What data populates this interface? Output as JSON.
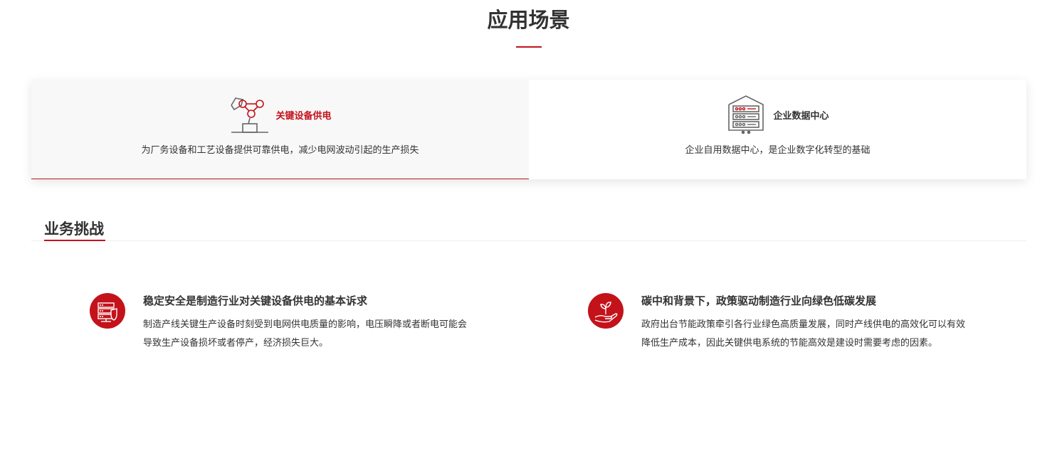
{
  "section": {
    "title": "应用场景"
  },
  "scenarios": [
    {
      "label": "关键设备供电",
      "icon": "robot-arm-icon",
      "description": "为厂务设备和工艺设备提供可靠供电，减少电网波动引起的生产损失",
      "active": true
    },
    {
      "label": "企业数据中心",
      "icon": "server-rack-icon",
      "description": "企业自用数据中心，是企业数字化转型的基础",
      "active": false
    }
  ],
  "challenges": {
    "title": "业务挑战",
    "items": [
      {
        "heading": "稳定安全是制造行业对关键设备供电的基本诉求",
        "body": "制造产线关键生产设备时刻受到电网供电质量的影响，电压瞬降或者断电可能会导致生产设备损坏或者停产，经济损失巨大。",
        "icon": "server-shield-icon"
      },
      {
        "heading": "碳中和背景下，政策驱动制造行业向绿色低碳发展",
        "body": "政府出台节能政策牵引各行业绿色高质量发展，同时产线供电的高效化可以有效降低生产成本，因此关键供电系统的节能高效是建设时需要考虑的因素。",
        "icon": "hand-plant-icon"
      }
    ]
  },
  "colors": {
    "accent": "#c4121b",
    "text": "#333333",
    "active_bg": "#f8f8f8"
  }
}
